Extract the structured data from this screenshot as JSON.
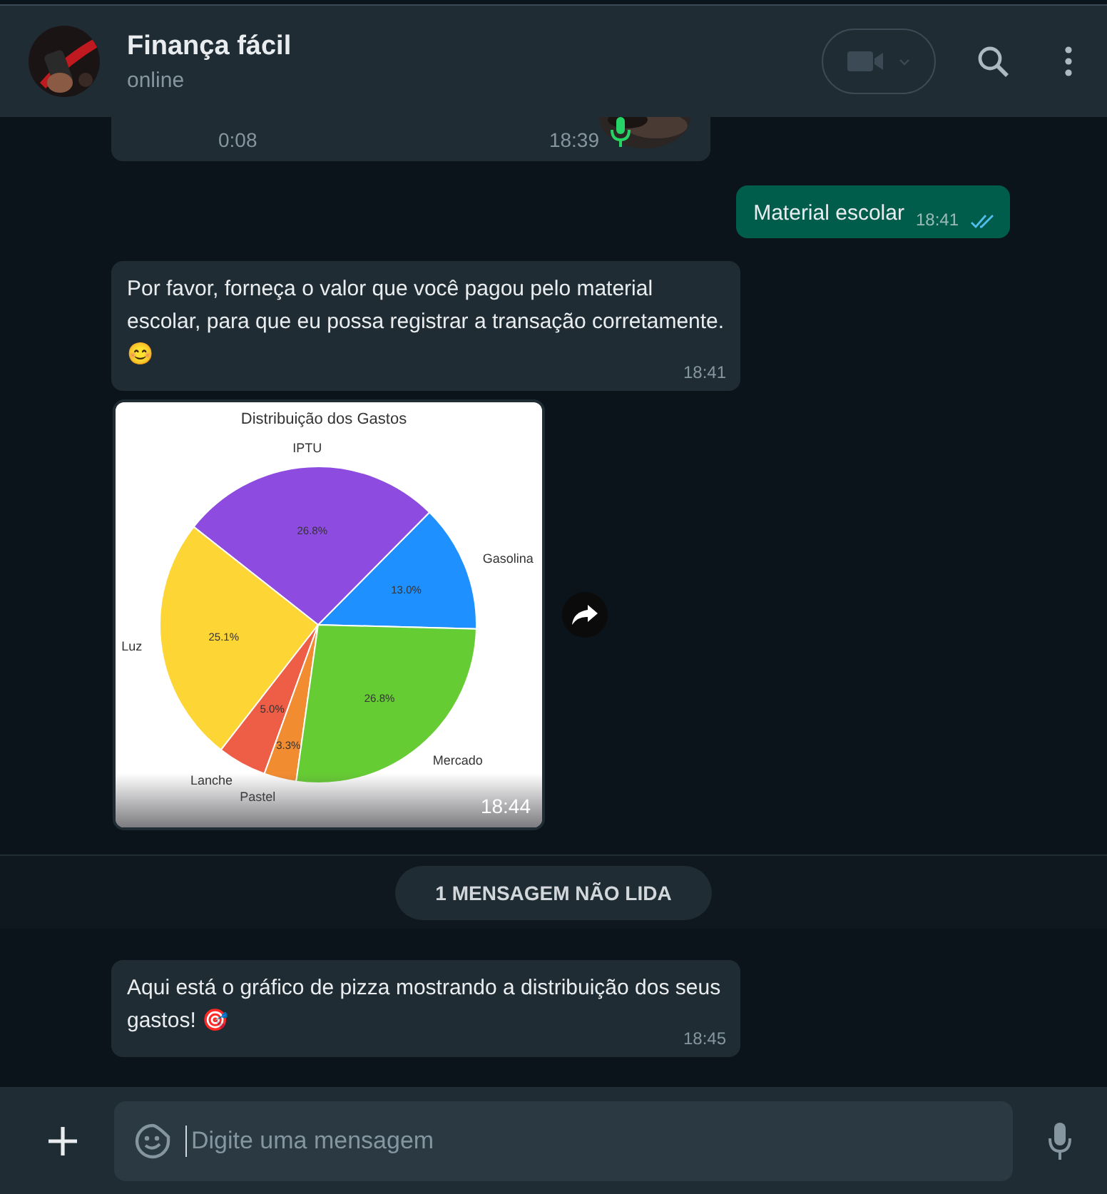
{
  "header": {
    "name": "Finança fácil",
    "status": "online"
  },
  "messages": [
    {
      "kind": "voice",
      "duration": "0:08",
      "time": "18:39"
    },
    {
      "kind": "outgoing",
      "text": "Material escolar",
      "time": "18:41",
      "read": true
    },
    {
      "kind": "incoming",
      "text": "Por favor, forneça o valor que você pagou pelo material escolar, para que eu possa registrar a transação corretamente. 😊",
      "time": "18:41"
    },
    {
      "time": "18:44",
      "chart_data": {
        "type": "pie",
        "title": "Distribuição dos Gastos",
        "categories": [
          "Gasolina",
          "IPTU",
          "Luz",
          "Lanche",
          "Pastel",
          "Mercado"
        ],
        "values": [
          13.0,
          26.8,
          25.1,
          5.0,
          3.3,
          26.8
        ],
        "colors": [
          "#1e90ff",
          "#8e4be0",
          "#fdd535",
          "#ee5d45",
          "#f28c30",
          "#66cc33"
        ],
        "value_labels": [
          "13.0%",
          "26.8%",
          "25.1%",
          "5.0%",
          "3.3%",
          "26.8%"
        ]
      }
    },
    {
      "kind": "unread",
      "text": "1 MENSAGEM NÃO LIDA"
    },
    {
      "kind": "incoming",
      "text": "Aqui está o gráfico de pizza mostrando a distribuição dos seus gastos! 🎯",
      "time": "18:45"
    }
  ],
  "composer": {
    "placeholder": "Digite uma mensagem"
  }
}
